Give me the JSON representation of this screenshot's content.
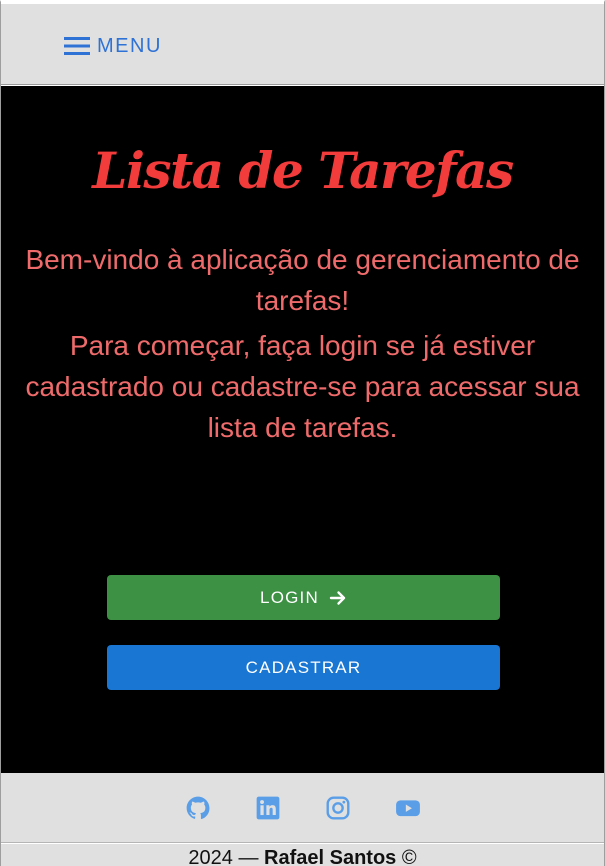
{
  "header": {
    "menu_label": "MENU",
    "menu_icon": "hamburger-icon"
  },
  "main": {
    "title": "Lista de Tarefas",
    "welcome": "Bem-vindo à aplicação de gerenciamento de tarefas!",
    "instructions": "Para começar, faça login se já estiver cadastrado ou cadastre-se para acessar sua lista de tarefas.",
    "login_label": "LOGIN",
    "login_icon": "arrow-right-icon",
    "register_label": "CADASTRAR"
  },
  "footer": {
    "social": [
      {
        "name": "github",
        "icon": "github-icon"
      },
      {
        "name": "linkedin",
        "icon": "linkedin-icon"
      },
      {
        "name": "instagram",
        "icon": "instagram-icon"
      },
      {
        "name": "youtube",
        "icon": "youtube-icon"
      }
    ],
    "year_prefix": "2024 —",
    "author": "Rafael Santos",
    "copyright": "©"
  },
  "colors": {
    "accent": "#2f72d6",
    "title": "#f23c3c",
    "text": "#ef6b6b",
    "login_button": "#3d9144",
    "register_button": "#1976d2",
    "social_icon": "#5b9ee8"
  }
}
